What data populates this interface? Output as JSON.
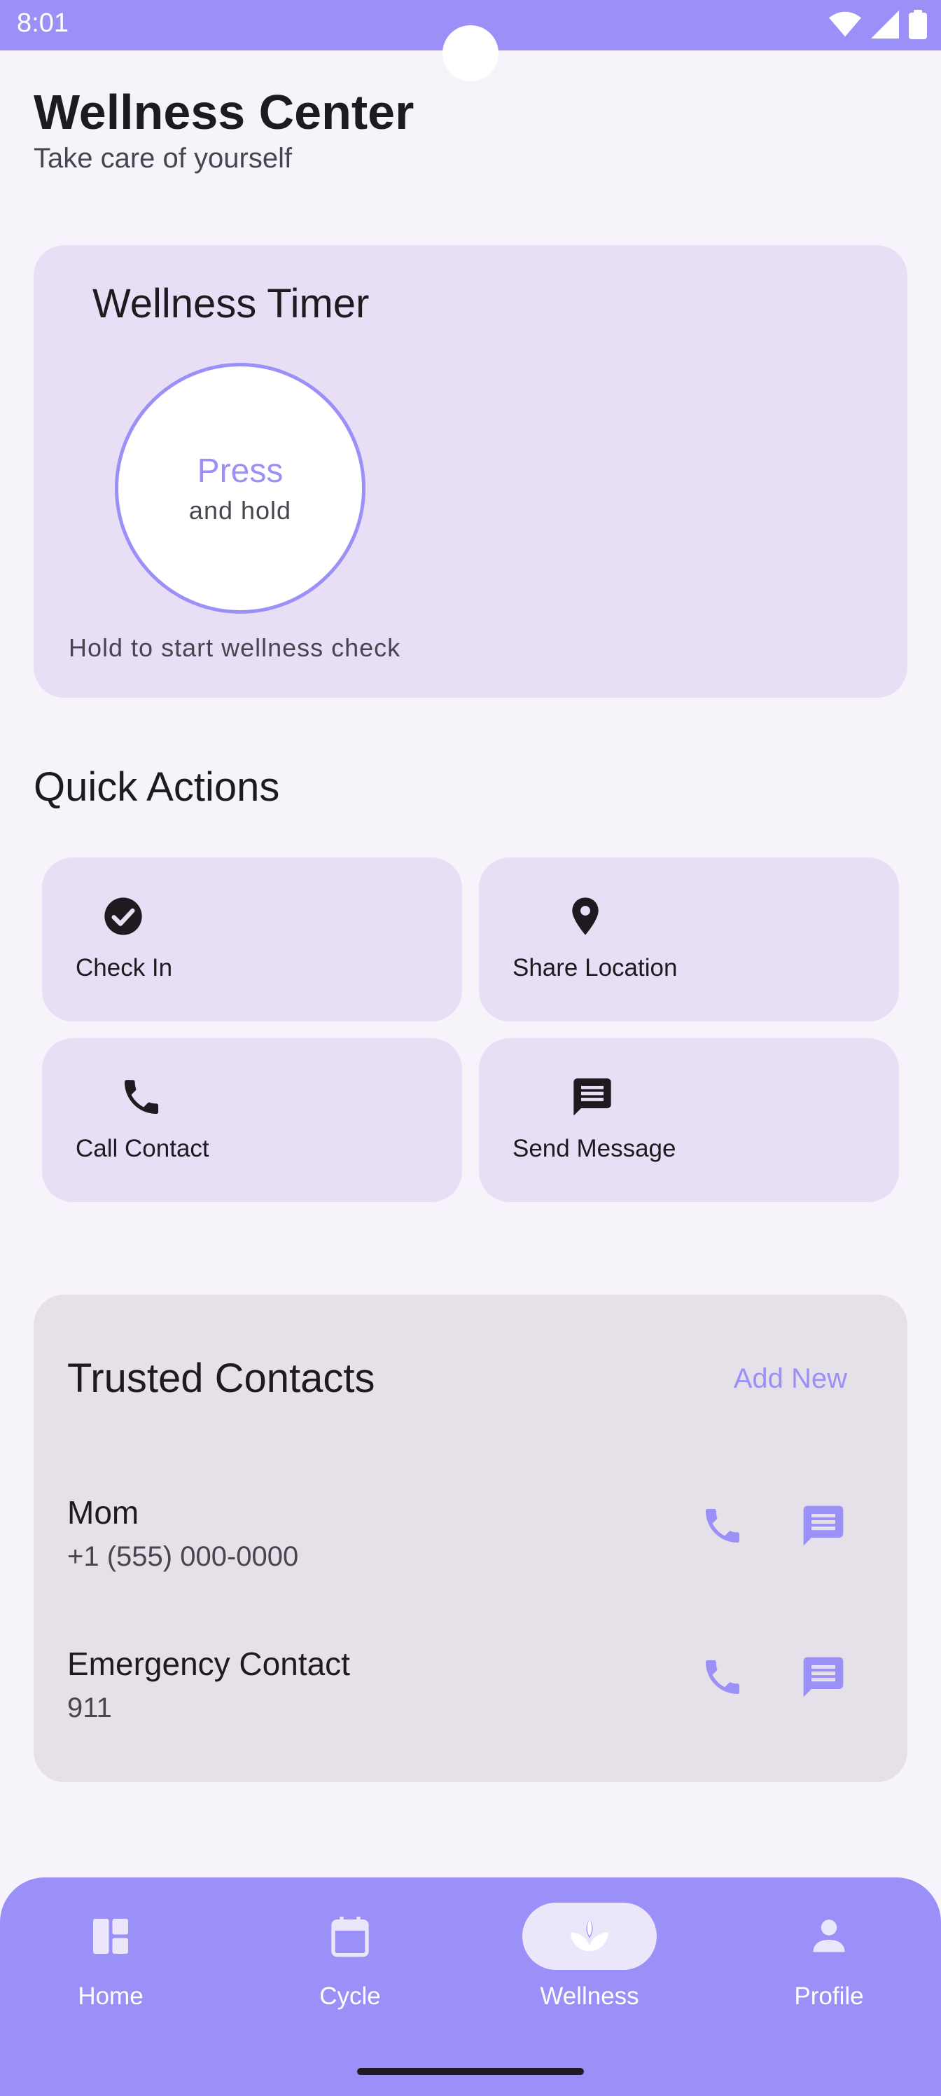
{
  "status_bar": {
    "time": "8:01"
  },
  "header": {
    "title": "Wellness Center",
    "subtitle": "Take care of yourself"
  },
  "timer": {
    "title": "Wellness Timer",
    "button_primary": "Press",
    "button_secondary": "and hold",
    "hint": "Hold to start wellness check"
  },
  "quick_actions": {
    "title": "Quick Actions",
    "items": [
      {
        "label": "Check In",
        "icon": "check-circle-icon"
      },
      {
        "label": "Share Location",
        "icon": "location-pin-icon"
      },
      {
        "label": "Call Contact",
        "icon": "phone-icon"
      },
      {
        "label": "Send Message",
        "icon": "message-icon"
      }
    ]
  },
  "contacts": {
    "title": "Trusted Contacts",
    "add_label": "Add New",
    "items": [
      {
        "name": "Mom",
        "phone": "+1 (555) 000-0000"
      },
      {
        "name": "Emergency Contact",
        "phone": "911"
      }
    ]
  },
  "bottom_nav": {
    "items": [
      {
        "label": "Home",
        "icon": "dashboard-icon",
        "active": false
      },
      {
        "label": "Cycle",
        "icon": "calendar-icon",
        "active": false
      },
      {
        "label": "Wellness",
        "icon": "lotus-icon",
        "active": true
      },
      {
        "label": "Profile",
        "icon": "person-icon",
        "active": false
      }
    ]
  },
  "colors": {
    "accent": "#9a90f7",
    "card": "#e8def5",
    "contacts_card": "#e6e0e8",
    "background": "#f6f3fb"
  }
}
